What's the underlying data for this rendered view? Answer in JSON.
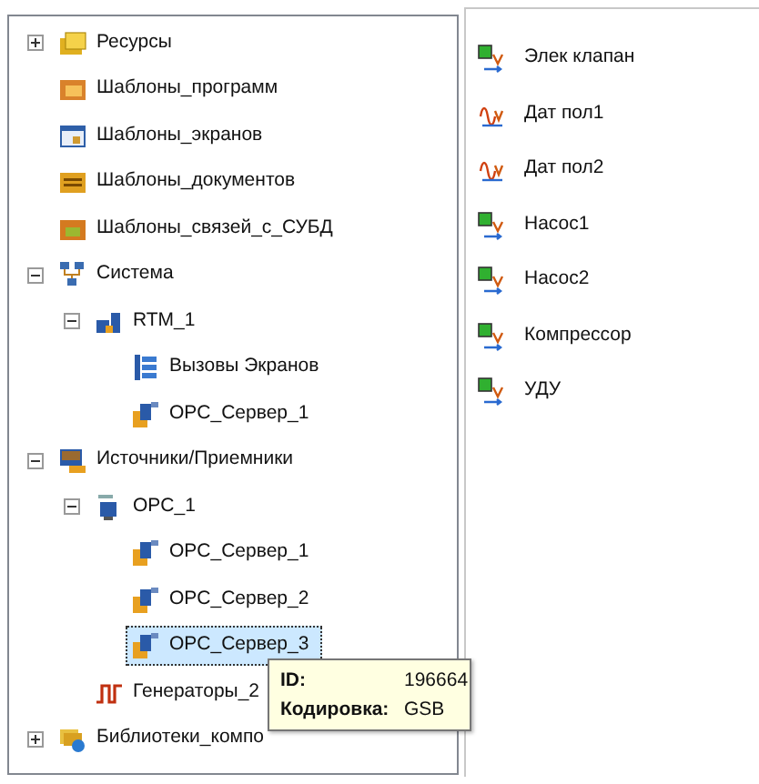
{
  "tree": [
    {
      "label": "Ресурсы",
      "kind": "folder",
      "expanded": false,
      "selected": false
    },
    {
      "label": "Шаблоны_программ",
      "kind": "program-template",
      "selected": false
    },
    {
      "label": "Шаблоны_экранов",
      "kind": "screen-template",
      "selected": false
    },
    {
      "label": "Шаблоны_документов",
      "kind": "document-template",
      "selected": false
    },
    {
      "label": "Шаблоны_связей_с_СУБД",
      "kind": "db-template",
      "selected": false
    },
    {
      "label": "Система",
      "kind": "system",
      "expanded": true,
      "selected": false,
      "children": [
        {
          "label": "RTM_1",
          "kind": "rtm",
          "expanded": true,
          "selected": false,
          "children": [
            {
              "label": "Вызовы Экранов",
              "kind": "screens",
              "selected": false
            },
            {
              "label": "OPC_Сервер_1",
              "kind": "server",
              "selected": false
            }
          ]
        }
      ]
    },
    {
      "label": "Источники/Приемники",
      "kind": "sources",
      "expanded": true,
      "selected": false,
      "children": [
        {
          "label": "OPC_1",
          "kind": "opc",
          "expanded": true,
          "selected": false,
          "children": [
            {
              "label": "OPC_Сервер_1",
              "kind": "server",
              "selected": false
            },
            {
              "label": "OPC_Сервер_2",
              "kind": "server",
              "selected": false
            },
            {
              "label": "OPC_Сервер_3",
              "kind": "server",
              "selected": true
            }
          ]
        },
        {
          "label": "Генераторы_2",
          "kind": "generator",
          "selected": false
        }
      ]
    },
    {
      "label": "Библиотеки_компо",
      "kind": "library",
      "expanded": false,
      "selected": false
    }
  ],
  "tooltip": {
    "rows": [
      {
        "key": "ID:",
        "value": "196664"
      },
      {
        "key": "Кодировка:",
        "value": "GSB"
      }
    ]
  },
  "list": [
    {
      "label": "Элек клапан",
      "kind": "block"
    },
    {
      "label": "Дат пол1",
      "kind": "sensor"
    },
    {
      "label": "Дат пол2",
      "kind": "sensor"
    },
    {
      "label": "Насос1",
      "kind": "block"
    },
    {
      "label": "Насос2",
      "kind": "block"
    },
    {
      "label": "Компрессор",
      "kind": "block"
    },
    {
      "label": "УДУ",
      "kind": "block"
    }
  ]
}
